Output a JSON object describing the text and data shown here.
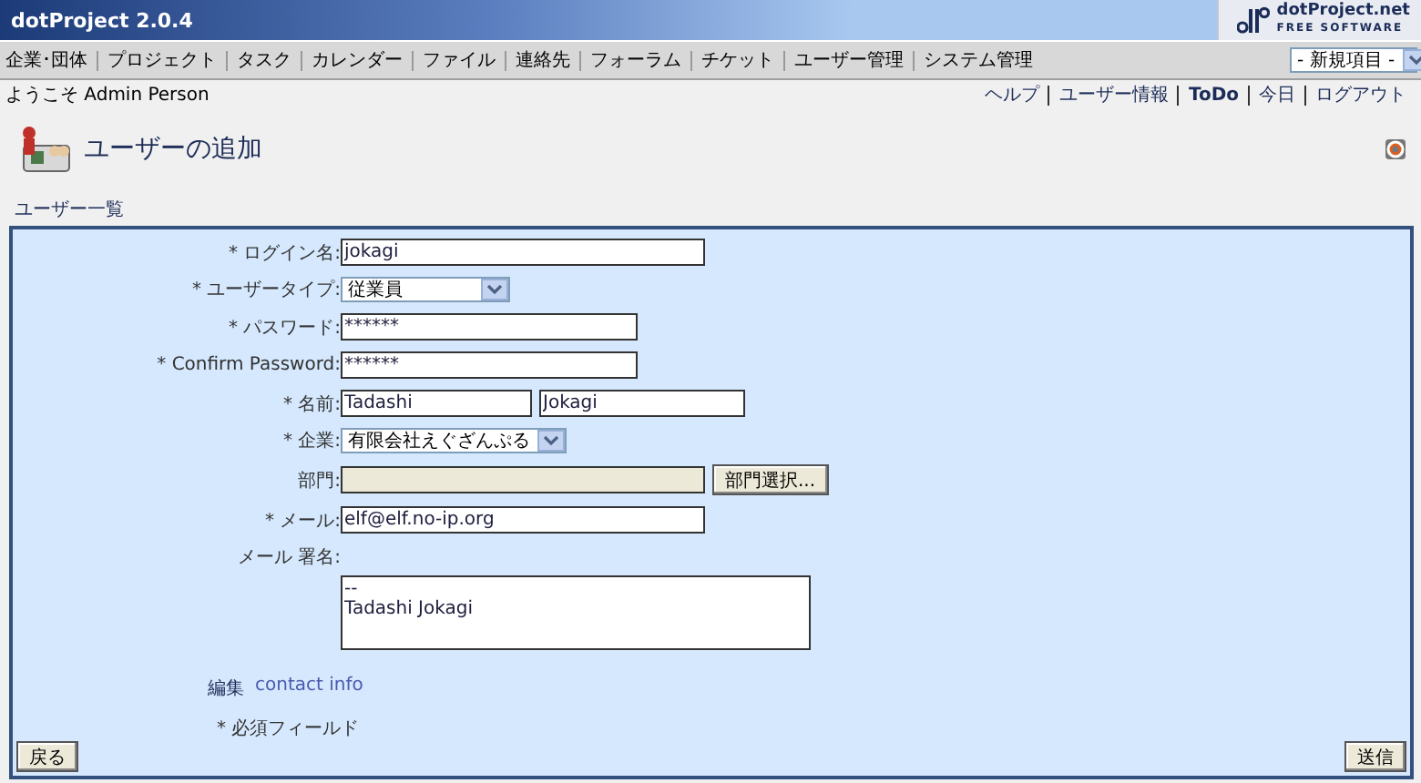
{
  "header": {
    "title": "dotProject 2.0.4",
    "brand": "dotProject.net",
    "brand_sub": "FREE SOFTWARE"
  },
  "nav": {
    "items": [
      "企業･団体",
      "プロジェクト",
      "タスク",
      "カレンダー",
      "ファイル",
      "連絡先",
      "フォーラム",
      "チケット",
      "ユーザー管理",
      "システム管理"
    ],
    "new_item": "- 新規項目 -"
  },
  "welcome": "ようこそ Admin Person",
  "top_links": [
    {
      "label": "ヘルプ",
      "bold": false
    },
    {
      "label": "ユーザー情報",
      "bold": false
    },
    {
      "label": "ToDo",
      "bold": true
    },
    {
      "label": "今日",
      "bold": false
    },
    {
      "label": "ログアウト",
      "bold": false
    }
  ],
  "page_title": "ユーザーの追加",
  "breadcrumb": "ユーザー一覧",
  "form": {
    "fields": [
      {
        "kind": "text",
        "label": "* ログイン名:",
        "value": "jokagi"
      },
      {
        "kind": "select",
        "label": "* ユーザータイプ:",
        "value": "従業員"
      },
      {
        "kind": "text",
        "label": "* パスワード:",
        "value": "******"
      },
      {
        "kind": "text",
        "label": "* Confirm Password:",
        "value": "******"
      },
      {
        "kind": "name",
        "label": "* 名前:",
        "value": "Tadashi",
        "value2": "Jokagi"
      },
      {
        "kind": "select",
        "label": "* 企業:",
        "value": "有限会社えぐざんぷる"
      },
      {
        "kind": "readonly",
        "label": "部門:",
        "button": "部門選択..."
      },
      {
        "kind": "text",
        "label": "* メール:",
        "value": "elf@elf.no-ip.org"
      },
      {
        "kind": "textarea",
        "label": "メール 署名:",
        "value": "--\nTadashi Jokagi"
      }
    ],
    "edit_label": "編集",
    "edit_link": "contact info",
    "required_note": "* 必須フィールド",
    "back_button": "戻る",
    "submit_button": "送信"
  }
}
